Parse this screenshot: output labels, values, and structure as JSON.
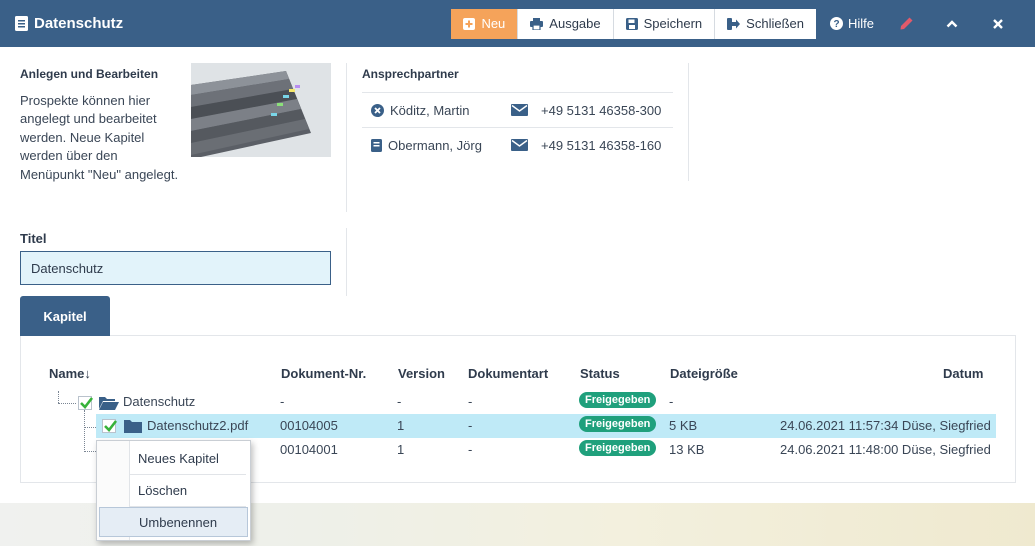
{
  "window": {
    "title": "Datenschutz"
  },
  "toolbar": {
    "new_label": "Neu",
    "output_label": "Ausgabe",
    "save_label": "Speichern",
    "close_label": "Schließen",
    "help_label": "Hilfe"
  },
  "info": {
    "heading": "Anlegen und Bearbeiten",
    "text": "Prospekte können hier angelegt und bearbeitet werden. Neue Kapitel werden über den Menüpunkt \"Neu\" angelegt."
  },
  "contacts": {
    "heading": "Ansprechpartner",
    "items": [
      {
        "name": "Köditz, Martin",
        "phone": "+49 5131 46358-300",
        "icon": "xing-icon"
      },
      {
        "name": "Obermann, Jörg",
        "phone": "+49 5131 46358-160",
        "icon": "book-icon"
      }
    ]
  },
  "titel": {
    "label": "Titel",
    "value": "Datenschutz"
  },
  "tabs": [
    {
      "label": "Kapitel"
    }
  ],
  "table": {
    "headers": {
      "name": "Name↓",
      "docnr": "Dokument-Nr.",
      "version": "Version",
      "doctype": "Dokumentart",
      "status": "Status",
      "size": "Dateigröße",
      "date": "Datum"
    },
    "rows": [
      {
        "name": "Datenschutz",
        "docnr": "-",
        "version": "-",
        "doctype": "-",
        "status": "Freigegeben",
        "size": "-",
        "date": ""
      },
      {
        "name": "Datenschutz2.pdf",
        "docnr": "00104005",
        "version": "1",
        "doctype": "-",
        "status": "Freigegeben",
        "size": "5 KB",
        "date": "24.06.2021 11:57:34 Düse, Siegfried"
      },
      {
        "name": "",
        "docnr": "00104001",
        "version": "1",
        "doctype": "-",
        "status": "Freigegeben",
        "size": "13 KB",
        "date": "24.06.2021 11:48:00 Düse, Siegfried"
      }
    ]
  },
  "context_menu": {
    "items": [
      {
        "label": "Neues Kapitel"
      },
      {
        "label": "Löschen"
      },
      {
        "label": "Umbenennen"
      }
    ]
  },
  "colors": {
    "header": "#3a6088",
    "accent_new": "#f5a35a",
    "badge": "#1fa07c",
    "highlight": "#bfeaf7"
  }
}
